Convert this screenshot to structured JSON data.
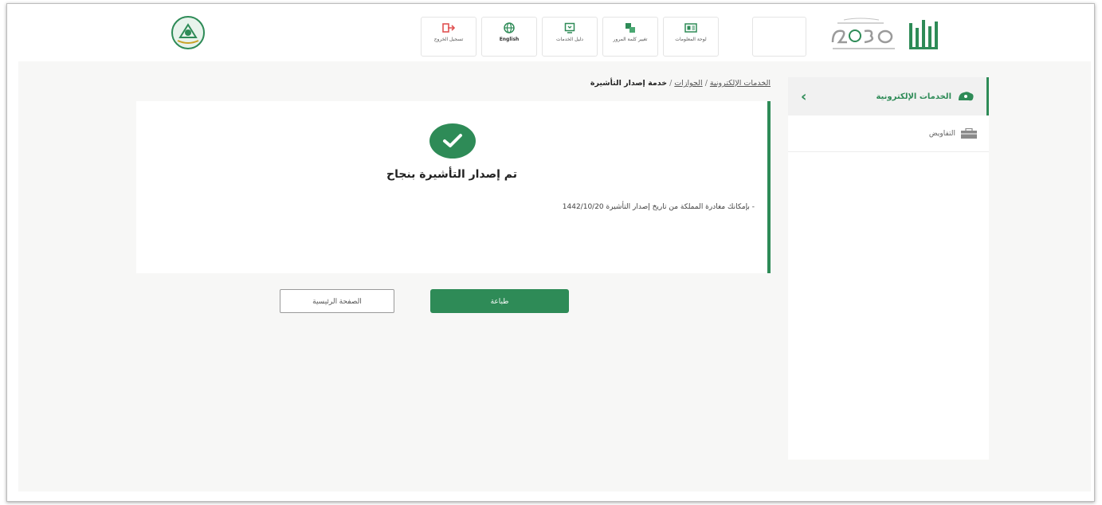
{
  "header": {
    "nav_items": [
      {
        "label": "تسجيل الخروج",
        "icon": "logout-icon",
        "color": "#e05252"
      },
      {
        "label": "English",
        "icon": "globe-icon",
        "color": "#2e8b57"
      },
      {
        "label": "دليل الخدمات",
        "icon": "guide-icon",
        "color": "#2e8b57"
      },
      {
        "label": "تغيير كلمة المرور",
        "icon": "password-icon",
        "color": "#2e8b57"
      },
      {
        "label": "لوحة المعلومات",
        "icon": "dashboard-icon",
        "color": "#2e8b57"
      }
    ]
  },
  "sidebar": {
    "active": {
      "label": "الخدمات الإلكترونية"
    },
    "items": [
      {
        "label": "التفاويض"
      }
    ]
  },
  "breadcrumb": {
    "crumb1": "الخدمات الإلكترونية",
    "crumb2": "الجوازات",
    "current": "خدمة إصدار التأشيرة",
    "sep": "/"
  },
  "card": {
    "title": "تم إصدار التأشيرة بنجاح",
    "note": "- بإمكانك مغادرة المملكة من تاريخ إصدار التأشيرة 1442/10/20"
  },
  "buttons": {
    "print": "طباعة",
    "home": "الصفحة الرئيسية"
  },
  "colors": {
    "accent": "#2e8b57",
    "logout": "#e05252"
  }
}
